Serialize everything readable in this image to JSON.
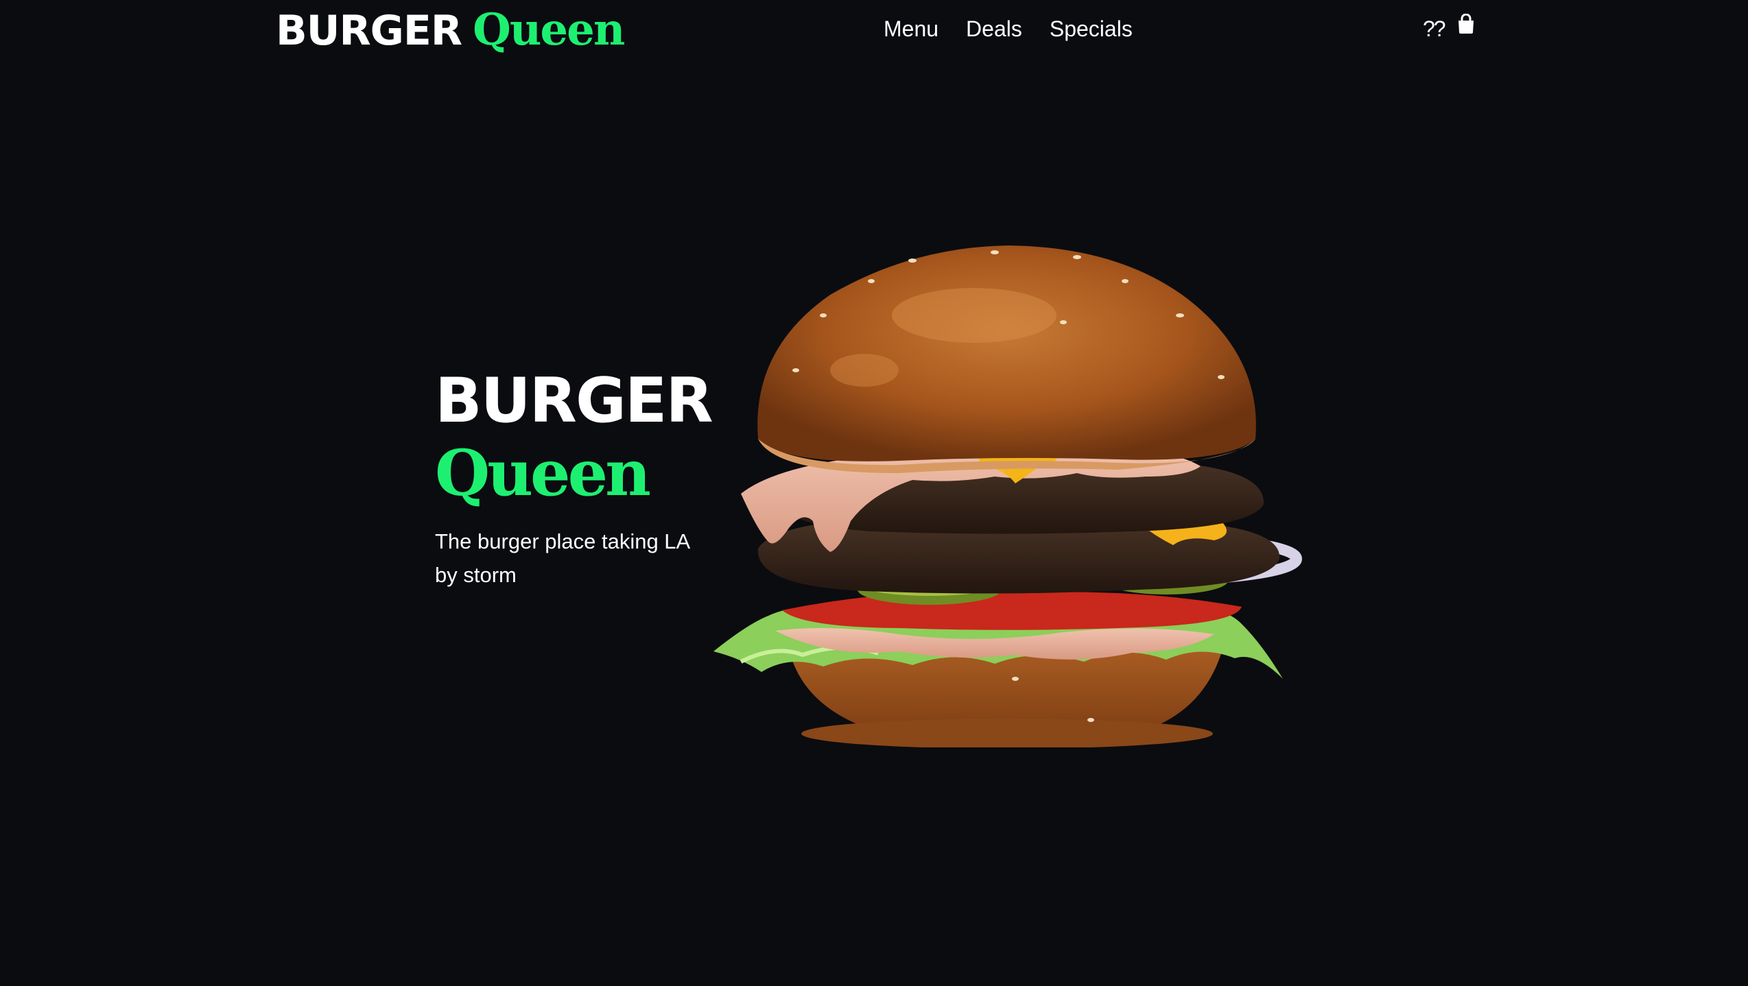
{
  "header": {
    "logo": {
      "word1": "BURGER",
      "word2": "Queen"
    },
    "nav": [
      {
        "label": "Menu"
      },
      {
        "label": "Deals"
      },
      {
        "label": "Specials"
      }
    ],
    "help_text": "??",
    "bag_icon": "shopping-bag-icon"
  },
  "hero": {
    "title_line1": "BURGER",
    "title_line2": "Queen",
    "tagline": "The burger place taking LA by storm",
    "image": "double cheeseburger with lettuce, tomato, pickles, onion and sauce"
  },
  "colors": {
    "background": "#0b0c10",
    "accent": "#1df071",
    "text": "#ffffff"
  }
}
